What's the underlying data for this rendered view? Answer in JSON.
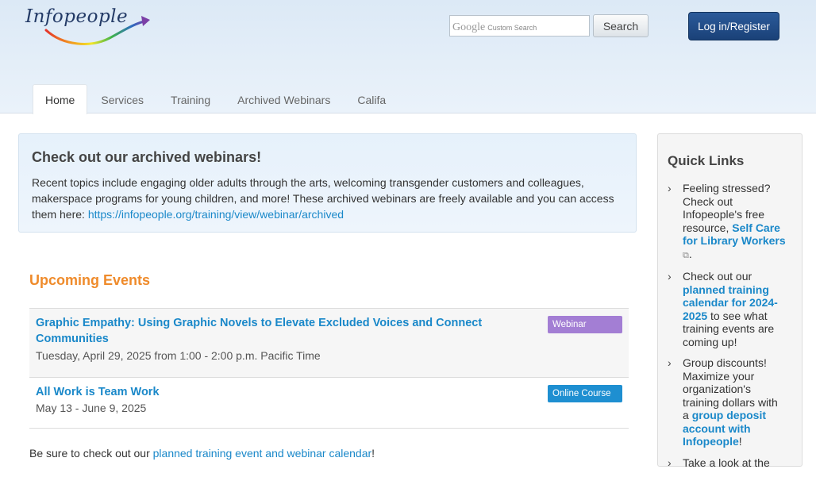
{
  "header": {
    "logo_text": "Infopeople",
    "search": {
      "watermark_google": "Google",
      "watermark_suffix": "Custom Search",
      "placeholder": "",
      "button_label": "Search"
    },
    "login_label": "Log in/Register",
    "nav": [
      "Home",
      "Services",
      "Training",
      "Archived Webinars",
      "Califa"
    ]
  },
  "announcement": {
    "title": "Check out our archived webinars!",
    "body": "Recent topics include engaging older adults through the arts, welcoming transgender customers and colleagues, makerspace programs for young children, and more! These archived webinars are freely available and you can access them here: ",
    "link": "https://infopeople.org/training/view/webinar/archived"
  },
  "events": {
    "title": "Upcoming Events",
    "items": [
      {
        "title": "Graphic Empathy: Using Graphic Novels to Elevate Excluded Voices and Connect Communities",
        "date": "Tuesday, April 29, 2025 from 1:00 - 2:00 p.m. Pacific Time",
        "badge": "Webinar"
      },
      {
        "title": "All Work is Team Work",
        "date": "May 13 - June 9, 2025",
        "badge": "Online Course"
      }
    ],
    "footer_before": "Be sure to check out our ",
    "footer_link": "planned training event and webinar calendar",
    "footer_after": "!"
  },
  "quick_links": {
    "title": "Quick Links",
    "items": [
      {
        "before": "Feeling stressed? Check out Infopeople's free resource, ",
        "link": "Self Care for Library Workers",
        "after": "."
      },
      {
        "before": "Check out our ",
        "link": "planned training calendar for 2024-2025",
        "after": " to see what training events are coming up!"
      },
      {
        "before": "Group discounts! Maximize your organization's training dollars with a ",
        "link": "group deposit account with Infopeople",
        "after": "!"
      },
      {
        "before": "Take a look at the",
        "link": "",
        "after": ""
      }
    ]
  },
  "colors": {
    "brand_navy": "#1a4178",
    "link": "#1a88c9",
    "events_heading": "#ef8b2b",
    "webinar_badge": "#a37ed4",
    "online_badge": "#1e8fd1"
  },
  "icons": {
    "chevron": "chevron-right-icon",
    "external": "external-link-icon"
  }
}
